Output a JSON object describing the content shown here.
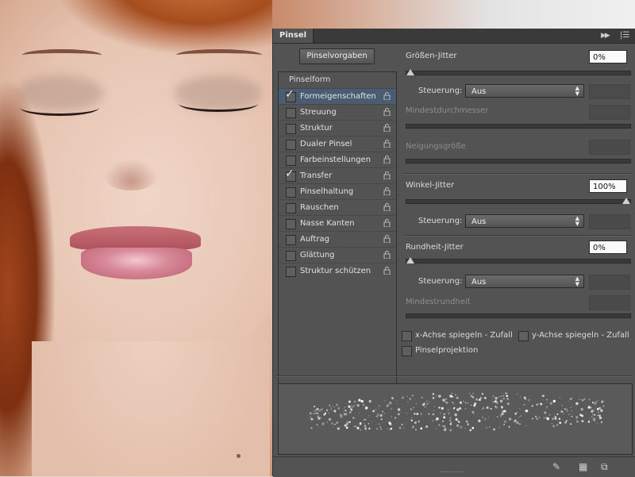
{
  "panel": {
    "tab_label": "Pinsel",
    "presets_button": "Pinselvorgaben",
    "list_header": "Pinselform",
    "options": [
      {
        "label": "Formeigenschaften",
        "checked": true,
        "selected": true
      },
      {
        "label": "Streuung",
        "checked": false,
        "selected": false
      },
      {
        "label": "Struktur",
        "checked": false,
        "selected": false
      },
      {
        "label": "Dualer Pinsel",
        "checked": false,
        "selected": false
      },
      {
        "label": "Farbeinstellungen",
        "checked": false,
        "selected": false
      },
      {
        "label": "Transfer",
        "checked": true,
        "selected": false
      },
      {
        "label": "Pinselhaltung",
        "checked": false,
        "selected": false
      },
      {
        "label": "Rauschen",
        "checked": false,
        "selected": false
      },
      {
        "label": "Nasse Kanten",
        "checked": false,
        "selected": false
      },
      {
        "label": "Auftrag",
        "checked": false,
        "selected": false
      },
      {
        "label": "Glättung",
        "checked": false,
        "selected": false
      },
      {
        "label": "Struktur schützen",
        "checked": false,
        "selected": false
      }
    ],
    "settings": {
      "size_jitter": {
        "label": "Größen-Jitter",
        "value": "0%",
        "fraction": 0
      },
      "size_control": {
        "label": "Steuerung:",
        "value": "Aus"
      },
      "min_diameter": {
        "label": "Mindestdurchmesser"
      },
      "tilt_scale": {
        "label": "Neigungsgröße"
      },
      "angle_jitter": {
        "label": "Winkel-Jitter",
        "value": "100%",
        "fraction": 1
      },
      "angle_control": {
        "label": "Steuerung:",
        "value": "Aus"
      },
      "roundness_jitter": {
        "label": "Rundheit-Jitter",
        "value": "0%",
        "fraction": 0
      },
      "roundness_control": {
        "label": "Steuerung:",
        "value": "Aus"
      },
      "min_roundness": {
        "label": "Mindestrundheit"
      },
      "flip_x": {
        "label": "x-Achse spiegeln - Zufall",
        "checked": false
      },
      "flip_y": {
        "label": "y-Achse spiegeln - Zufall",
        "checked": false
      },
      "projection": {
        "label": "Pinselprojektion",
        "checked": false
      }
    },
    "footer_icons": [
      "brush-toggle-icon",
      "grid-icon",
      "new-preset-icon"
    ]
  }
}
